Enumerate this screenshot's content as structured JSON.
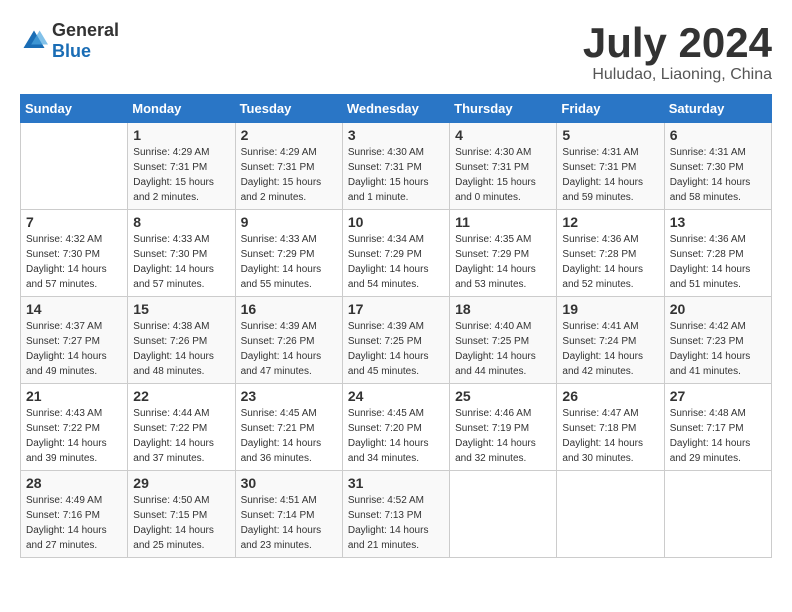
{
  "header": {
    "logo_general": "General",
    "logo_blue": "Blue",
    "month_title": "July 2024",
    "location": "Huludao, Liaoning, China"
  },
  "days_of_week": [
    "Sunday",
    "Monday",
    "Tuesday",
    "Wednesday",
    "Thursday",
    "Friday",
    "Saturday"
  ],
  "weeks": [
    [
      {
        "day": "",
        "info": ""
      },
      {
        "day": "1",
        "info": "Sunrise: 4:29 AM\nSunset: 7:31 PM\nDaylight: 15 hours\nand 2 minutes."
      },
      {
        "day": "2",
        "info": "Sunrise: 4:29 AM\nSunset: 7:31 PM\nDaylight: 15 hours\nand 2 minutes."
      },
      {
        "day": "3",
        "info": "Sunrise: 4:30 AM\nSunset: 7:31 PM\nDaylight: 15 hours\nand 1 minute."
      },
      {
        "day": "4",
        "info": "Sunrise: 4:30 AM\nSunset: 7:31 PM\nDaylight: 15 hours\nand 0 minutes."
      },
      {
        "day": "5",
        "info": "Sunrise: 4:31 AM\nSunset: 7:31 PM\nDaylight: 14 hours\nand 59 minutes."
      },
      {
        "day": "6",
        "info": "Sunrise: 4:31 AM\nSunset: 7:30 PM\nDaylight: 14 hours\nand 58 minutes."
      }
    ],
    [
      {
        "day": "7",
        "info": "Sunrise: 4:32 AM\nSunset: 7:30 PM\nDaylight: 14 hours\nand 57 minutes."
      },
      {
        "day": "8",
        "info": "Sunrise: 4:33 AM\nSunset: 7:30 PM\nDaylight: 14 hours\nand 57 minutes."
      },
      {
        "day": "9",
        "info": "Sunrise: 4:33 AM\nSunset: 7:29 PM\nDaylight: 14 hours\nand 55 minutes."
      },
      {
        "day": "10",
        "info": "Sunrise: 4:34 AM\nSunset: 7:29 PM\nDaylight: 14 hours\nand 54 minutes."
      },
      {
        "day": "11",
        "info": "Sunrise: 4:35 AM\nSunset: 7:29 PM\nDaylight: 14 hours\nand 53 minutes."
      },
      {
        "day": "12",
        "info": "Sunrise: 4:36 AM\nSunset: 7:28 PM\nDaylight: 14 hours\nand 52 minutes."
      },
      {
        "day": "13",
        "info": "Sunrise: 4:36 AM\nSunset: 7:28 PM\nDaylight: 14 hours\nand 51 minutes."
      }
    ],
    [
      {
        "day": "14",
        "info": "Sunrise: 4:37 AM\nSunset: 7:27 PM\nDaylight: 14 hours\nand 49 minutes."
      },
      {
        "day": "15",
        "info": "Sunrise: 4:38 AM\nSunset: 7:26 PM\nDaylight: 14 hours\nand 48 minutes."
      },
      {
        "day": "16",
        "info": "Sunrise: 4:39 AM\nSunset: 7:26 PM\nDaylight: 14 hours\nand 47 minutes."
      },
      {
        "day": "17",
        "info": "Sunrise: 4:39 AM\nSunset: 7:25 PM\nDaylight: 14 hours\nand 45 minutes."
      },
      {
        "day": "18",
        "info": "Sunrise: 4:40 AM\nSunset: 7:25 PM\nDaylight: 14 hours\nand 44 minutes."
      },
      {
        "day": "19",
        "info": "Sunrise: 4:41 AM\nSunset: 7:24 PM\nDaylight: 14 hours\nand 42 minutes."
      },
      {
        "day": "20",
        "info": "Sunrise: 4:42 AM\nSunset: 7:23 PM\nDaylight: 14 hours\nand 41 minutes."
      }
    ],
    [
      {
        "day": "21",
        "info": "Sunrise: 4:43 AM\nSunset: 7:22 PM\nDaylight: 14 hours\nand 39 minutes."
      },
      {
        "day": "22",
        "info": "Sunrise: 4:44 AM\nSunset: 7:22 PM\nDaylight: 14 hours\nand 37 minutes."
      },
      {
        "day": "23",
        "info": "Sunrise: 4:45 AM\nSunset: 7:21 PM\nDaylight: 14 hours\nand 36 minutes."
      },
      {
        "day": "24",
        "info": "Sunrise: 4:45 AM\nSunset: 7:20 PM\nDaylight: 14 hours\nand 34 minutes."
      },
      {
        "day": "25",
        "info": "Sunrise: 4:46 AM\nSunset: 7:19 PM\nDaylight: 14 hours\nand 32 minutes."
      },
      {
        "day": "26",
        "info": "Sunrise: 4:47 AM\nSunset: 7:18 PM\nDaylight: 14 hours\nand 30 minutes."
      },
      {
        "day": "27",
        "info": "Sunrise: 4:48 AM\nSunset: 7:17 PM\nDaylight: 14 hours\nand 29 minutes."
      }
    ],
    [
      {
        "day": "28",
        "info": "Sunrise: 4:49 AM\nSunset: 7:16 PM\nDaylight: 14 hours\nand 27 minutes."
      },
      {
        "day": "29",
        "info": "Sunrise: 4:50 AM\nSunset: 7:15 PM\nDaylight: 14 hours\nand 25 minutes."
      },
      {
        "day": "30",
        "info": "Sunrise: 4:51 AM\nSunset: 7:14 PM\nDaylight: 14 hours\nand 23 minutes."
      },
      {
        "day": "31",
        "info": "Sunrise: 4:52 AM\nSunset: 7:13 PM\nDaylight: 14 hours\nand 21 minutes."
      },
      {
        "day": "",
        "info": ""
      },
      {
        "day": "",
        "info": ""
      },
      {
        "day": "",
        "info": ""
      }
    ]
  ]
}
